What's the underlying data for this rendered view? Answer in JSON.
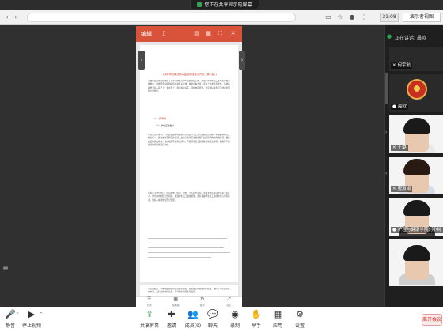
{
  "share_banner": {
    "text": "您正在共享显示的屏幕"
  },
  "browser": {
    "time": "31:08",
    "view_label": "演示者视图"
  },
  "document": {
    "title": "编辑",
    "heading": "《高等学校新冠肺炎疫情防控技术方案（第六版）》",
    "intro": "为做好疫情防控常态化下高等学校新冠肺炎疫情防控工作，保障广大师生员工生命安全和身体健康，根据国务院联防联控机制有关要求，特制定本方案，适用于各类高等学校。各地各校要坚持人民至上、生命至上，落实属地责任，强化校园管理，切实做好师生员工健康监测和日常防护。",
    "section_title": "一、开学前",
    "subsection_title": "（一）学校应当做好",
    "body": "1.建立防控体系。学校要根据本地疫情形势制定开学工作方案和应急预案，明确疫情防控工作责任人，建立健全联防联控机制。加强与属地卫生健康部门和疾控机构的沟通协调，储备必要的防疫物资，做好校园环境清洁消毒，开展师生员工健康教育和应急演练，确保开学后各项防控措施落实到位。",
    "body2": "2.落实“四方责任”。压实属地、部门、单位、个人四方责任，学校主要负责同志为第一责任人，健全校内防控工作机制，加强师生员工健康管理，及时掌握师生员工健康状况与行程信息，做好入校排查和登记管理。",
    "page2": "3.信息报告。学校要建立疫情信息报告制度，按照规定时限和程序报告。做好与学生及家长的沟通，及时发布防控信息，引导师生理性看待疫情。",
    "footer": [
      "目录",
      "缩略图",
      "旋转",
      "适应"
    ]
  },
  "right_panel": {
    "speaking_prefix": "正在讲话:",
    "speaking_name": "晨欧",
    "participants": [
      {
        "name": "何宇航"
      },
      {
        "name": "晨欧"
      },
      {
        "name": "王璐"
      },
      {
        "name": "唐淑娟"
      },
      {
        "name": "护理与健康学院刘小纯"
      },
      {
        "name": ""
      }
    ]
  },
  "toolbar": {
    "mute": "静音",
    "video": "停止视频",
    "share": "共享屏幕",
    "invite": "邀请",
    "members": "成员(9)",
    "chat": "聊天",
    "record": "录制",
    "raise": "举手",
    "apps": "应用",
    "settings": "设置",
    "exit": "离开会议"
  },
  "colors": {
    "doc_header": "#d9533b",
    "accent_green": "#2ea44f",
    "exit": "#d83b2b"
  }
}
